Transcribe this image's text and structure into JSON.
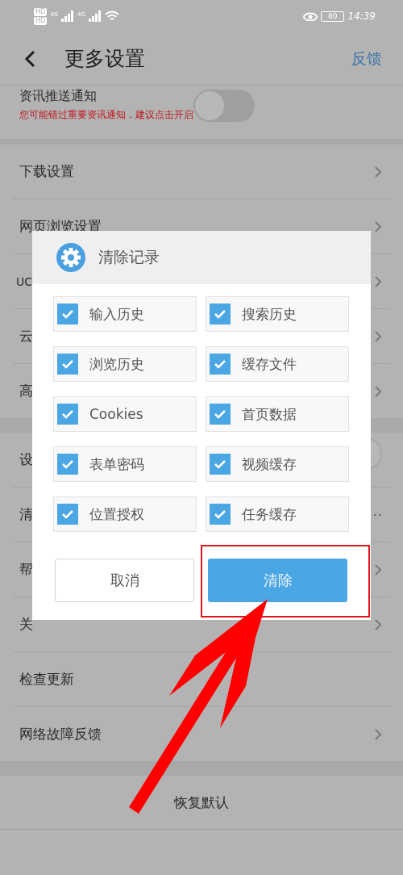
{
  "status_bar": {
    "hd_labels": [
      "HD",
      "HD"
    ],
    "network_labels": [
      "4G",
      "4G"
    ],
    "battery": "80",
    "time": "14:39"
  },
  "header": {
    "title": "更多设置",
    "action": "反馈"
  },
  "notification": {
    "title": "资讯推送通知",
    "hint": "您可能错过重要资讯通知，建议点击开启",
    "on": false
  },
  "sections": [
    {
      "rows": [
        {
          "label": "下载设置",
          "kind": "link"
        },
        {
          "label": "网页浏览设置",
          "kind": "link"
        },
        {
          "label": "UC",
          "kind": "link"
        },
        {
          "label": "云",
          "kind": "link"
        },
        {
          "label": "高",
          "kind": "link"
        }
      ]
    },
    {
      "rows": [
        {
          "label": "设",
          "kind": "toggle",
          "on": true
        },
        {
          "label": "清",
          "kind": "value",
          "value": "··"
        },
        {
          "label": "帮",
          "kind": "link"
        },
        {
          "label": "关",
          "kind": "link"
        },
        {
          "label": "检查更新",
          "kind": "plain"
        },
        {
          "label": "网络故障反馈",
          "kind": "link"
        }
      ]
    }
  ],
  "restore": "恢复默认",
  "dialog": {
    "title": "清除记录",
    "options": [
      {
        "label": "输入历史",
        "checked": true
      },
      {
        "label": "搜索历史",
        "checked": true
      },
      {
        "label": "浏览历史",
        "checked": true
      },
      {
        "label": "缓存文件",
        "checked": true
      },
      {
        "label": "Cookies",
        "checked": true
      },
      {
        "label": "首页数据",
        "checked": true
      },
      {
        "label": "表单密码",
        "checked": true
      },
      {
        "label": "视频缓存",
        "checked": true
      },
      {
        "label": "位置授权",
        "checked": true
      },
      {
        "label": "任务缓存",
        "checked": true
      }
    ],
    "buttons": [
      {
        "label": "取消",
        "kind": "secondary"
      },
      {
        "label": "清除",
        "kind": "primary"
      }
    ]
  }
}
